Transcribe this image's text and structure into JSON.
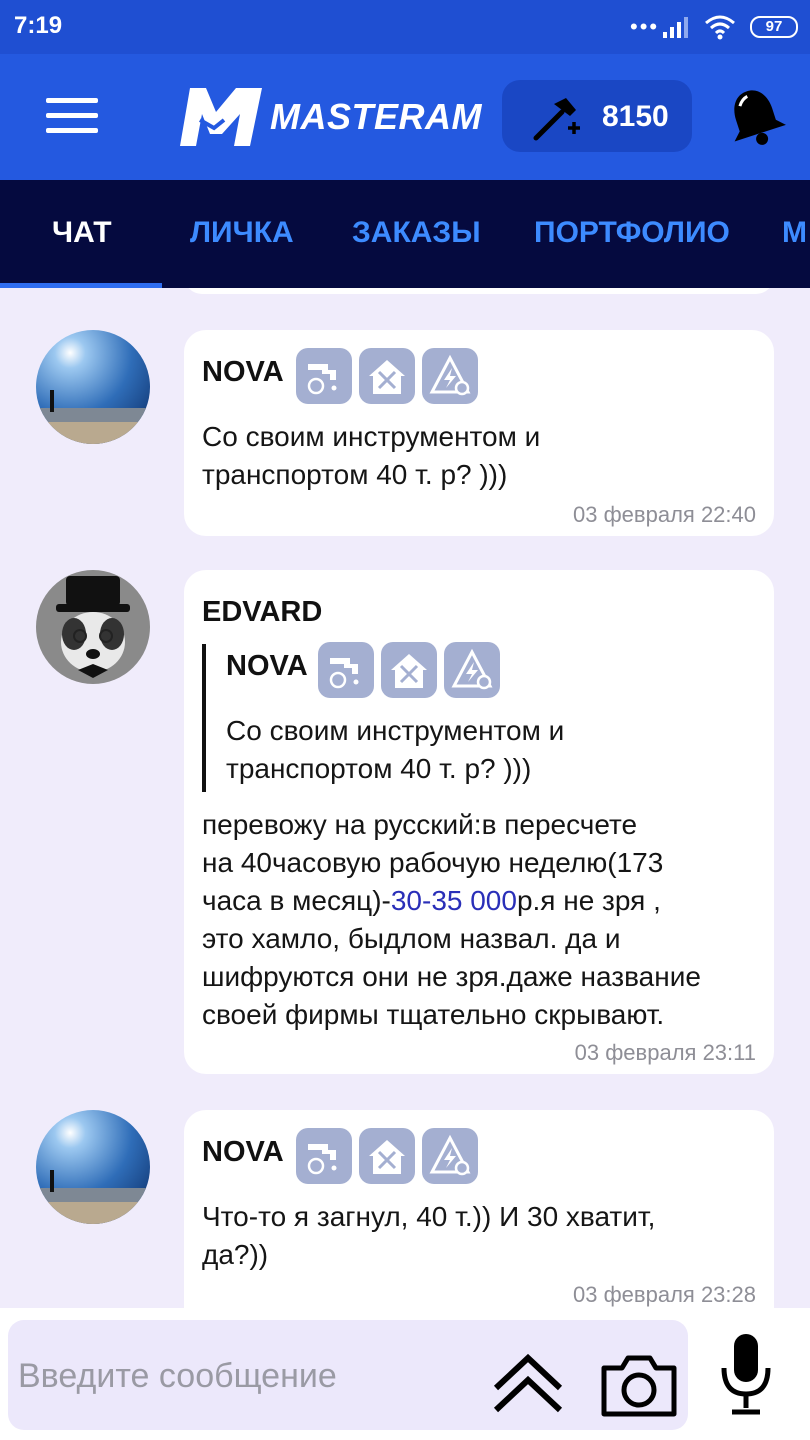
{
  "status_bar": {
    "time": "7:19",
    "dots": "•••",
    "battery": "97"
  },
  "header": {
    "app_name": "MASTERAM",
    "points": "8150"
  },
  "tabs": [
    {
      "label": "ЧАТ"
    },
    {
      "label": "ЛИЧКА"
    },
    {
      "label": "ЗАКАЗЫ"
    },
    {
      "label": "ПОРТФОЛИО"
    },
    {
      "label": "М"
    }
  ],
  "messages": [
    {
      "user": "NOVA",
      "badges": [
        "plumbing-icon",
        "house-tools-icon",
        "electrical-icon"
      ],
      "text_lines": [
        "Со своим инструментом и",
        "транспортом 40 т. р? )))"
      ],
      "time": "03 февраля 22:40"
    },
    {
      "user": "EDVARD",
      "quote": {
        "user": "NOVA",
        "badges": [
          "plumbing-icon",
          "house-tools-icon",
          "electrical-icon"
        ],
        "text_lines": [
          "Со своим инструментом и",
          "транспортом 40 т. р? )))"
        ]
      },
      "text": {
        "line1": "перевожу на русский:в пересчете",
        "line2": "на 40часовую рабочую неделю(173",
        "line3_pre": "часа в месяц)-",
        "line3_link": "30-35 000",
        "line3_post": "р.я не зря ,",
        "line4": "это хамло, быдлом назвал. да и",
        "line5": "шифруются они не зря.даже название",
        "line6": "своей фирмы тщательно скрывают."
      },
      "time": "03 февраля 23:11"
    },
    {
      "user": "NOVA",
      "badges": [
        "plumbing-icon",
        "house-tools-icon",
        "electrical-icon"
      ],
      "text_lines": [
        "Что-то я загнул, 40 т.)) И 30 хватит,",
        "да?))"
      ],
      "time": "03 февраля 23:28"
    }
  ],
  "input": {
    "placeholder": "Введите сообщение"
  },
  "colors": {
    "header": "#2459e0",
    "tabs_bg": "#050a3f",
    "tab_text": "#3d8bff",
    "badge": "#a4afd1",
    "link": "#2a2fb8"
  }
}
